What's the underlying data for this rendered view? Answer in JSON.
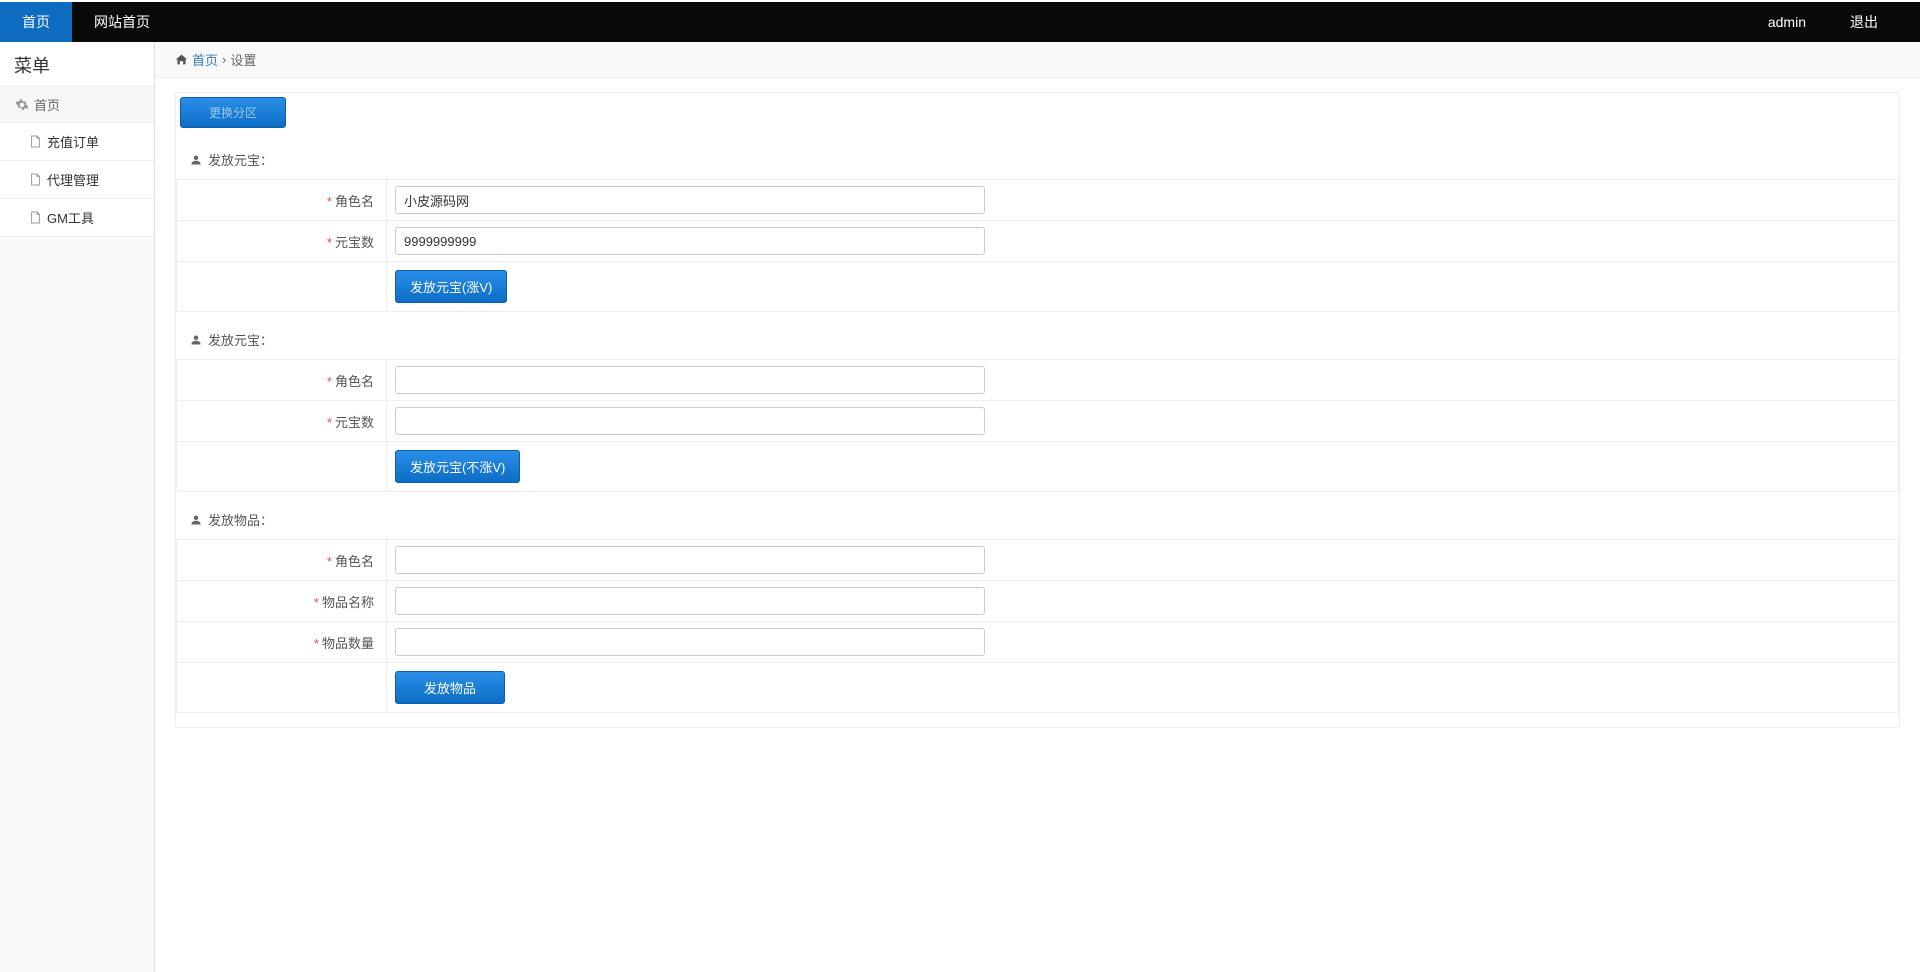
{
  "header": {
    "home": "首页",
    "site_home": "网站首页",
    "user": "admin",
    "logout": "退出"
  },
  "sidebar": {
    "title": "菜单",
    "head": "首页",
    "items": [
      "充值订单",
      "代理管理",
      "GM工具"
    ]
  },
  "breadcrumb": {
    "home": "首页",
    "current": "设置"
  },
  "switch_btn": "更换分区",
  "sections": {
    "s1": {
      "title": "发放元宝：",
      "label_role": "角色名",
      "label_amount": "元宝数",
      "value_role": "小皮源码网",
      "value_amount": "9999999999",
      "btn": "发放元宝(涨V)"
    },
    "s2": {
      "title": "发放元宝：",
      "label_role": "角色名",
      "label_amount": "元宝数",
      "value_role": "",
      "value_amount": "",
      "btn": "发放元宝(不涨V)"
    },
    "s3": {
      "title": "发放物品：",
      "label_role": "角色名",
      "label_item": "物品名称",
      "label_qty": "物品数量",
      "value_role": "",
      "value_item": "",
      "value_qty": "",
      "btn": "发放物品"
    }
  }
}
